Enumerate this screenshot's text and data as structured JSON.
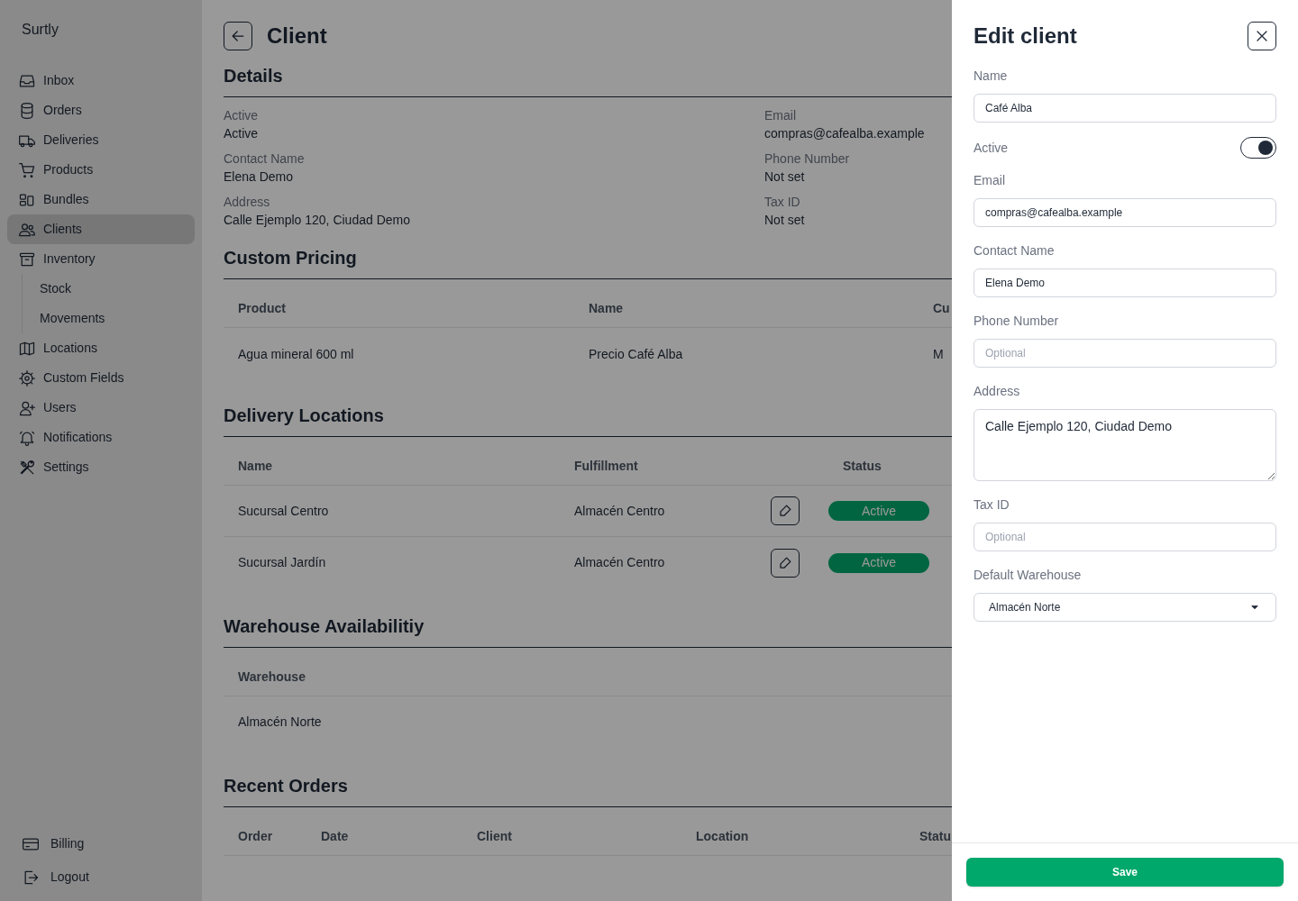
{
  "sidebar": {
    "brand": "Surtly",
    "items": [
      {
        "label": "Inbox",
        "selected": false
      },
      {
        "label": "Orders",
        "selected": false
      },
      {
        "label": "Deliveries",
        "selected": false
      },
      {
        "label": "Products",
        "selected": false
      },
      {
        "label": "Bundles",
        "selected": false
      },
      {
        "label": "Clients",
        "selected": true
      },
      {
        "label": "Inventory",
        "selected": false,
        "children": [
          {
            "label": "Stock",
            "selected": false
          },
          {
            "label": "Movements",
            "selected": false
          }
        ]
      },
      {
        "label": "Locations",
        "selected": false
      },
      {
        "label": "Custom Fields",
        "selected": false
      },
      {
        "label": "Users",
        "selected": false
      },
      {
        "label": "Notifications",
        "selected": false
      },
      {
        "label": "Settings",
        "selected": false
      }
    ],
    "footer_items": [
      {
        "label": "Billing"
      },
      {
        "label": "Logout"
      }
    ]
  },
  "page": {
    "title": "Client",
    "details": {
      "heading": "Details",
      "fields": [
        {
          "label": "Active",
          "value": "Active"
        },
        {
          "label": "Email",
          "value": "compras@cafealba.example"
        },
        {
          "label": "Contact Name",
          "value": "Elena Demo"
        },
        {
          "label": "Phone Number",
          "value": "Not set"
        },
        {
          "label": "Address",
          "value": "Calle Ejemplo 120, Ciudad Demo"
        },
        {
          "label": "Tax ID",
          "value": "Not set"
        }
      ]
    },
    "custom_pricing": {
      "heading": "Custom Pricing",
      "columns": [
        "Product",
        "Name",
        "Cu"
      ],
      "rows": [
        [
          "Agua mineral 600 ml",
          "Precio Café Alba",
          "M"
        ]
      ]
    },
    "delivery_locations": {
      "heading": "Delivery Locations",
      "columns": [
        "Name",
        "Fulfillment",
        "Status"
      ],
      "rows": [
        {
          "name": "Sucursal Centro",
          "fulfillment": "Almacén Centro",
          "status": "Active"
        },
        {
          "name": "Sucursal Jardín",
          "fulfillment": "Almacén Centro",
          "status": "Active"
        }
      ]
    },
    "warehouse_availability": {
      "heading": "Warehouse Availabilitiy",
      "columns": [
        "Warehouse"
      ],
      "rows": [
        [
          "Almacén Norte"
        ]
      ]
    },
    "recent_orders": {
      "heading": "Recent Orders",
      "columns": [
        "Order",
        "Date",
        "Client",
        "Location",
        "Statu"
      ]
    }
  },
  "edit_panel": {
    "title": "Edit client",
    "fields": [
      {
        "kind": "text",
        "label": "Name",
        "value": "Café Alba"
      },
      {
        "kind": "toggle",
        "label": "Active",
        "on": true
      },
      {
        "kind": "text",
        "label": "Email",
        "value": "compras@cafealba.example"
      },
      {
        "kind": "text",
        "label": "Contact Name",
        "value": "Elena Demo"
      },
      {
        "kind": "text",
        "label": "Phone Number",
        "placeholder": "Optional"
      },
      {
        "kind": "textarea",
        "label": "Address",
        "value": "Calle Ejemplo 120, Ciudad Demo"
      },
      {
        "kind": "text",
        "label": "Tax ID",
        "placeholder": "Optional"
      },
      {
        "kind": "select",
        "label": "Default Warehouse",
        "value": "Almacén Norte"
      }
    ],
    "save_button": "Save"
  }
}
